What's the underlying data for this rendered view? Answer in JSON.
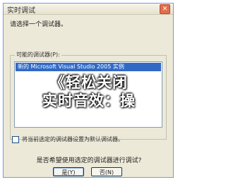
{
  "window": {
    "title": "实时调试",
    "close_glyph": "✕"
  },
  "prompt": "请选择一个调试器。",
  "debuggers": {
    "label": "可能的调试器(P):",
    "items": [
      {
        "label": "新的 Microsoft Visual Studio 2005 实例",
        "selected": true
      }
    ]
  },
  "overlay": {
    "line1": "《轻松关闭",
    "line2": "实时音效：操"
  },
  "default_checkbox": {
    "label": "将当前选定的调试器设置为默认调试器。",
    "checked": false
  },
  "question": "是否希望使用选定的调试器进行调试?",
  "buttons": {
    "yes_label": "是(Y)",
    "no_label": "否(N)"
  }
}
